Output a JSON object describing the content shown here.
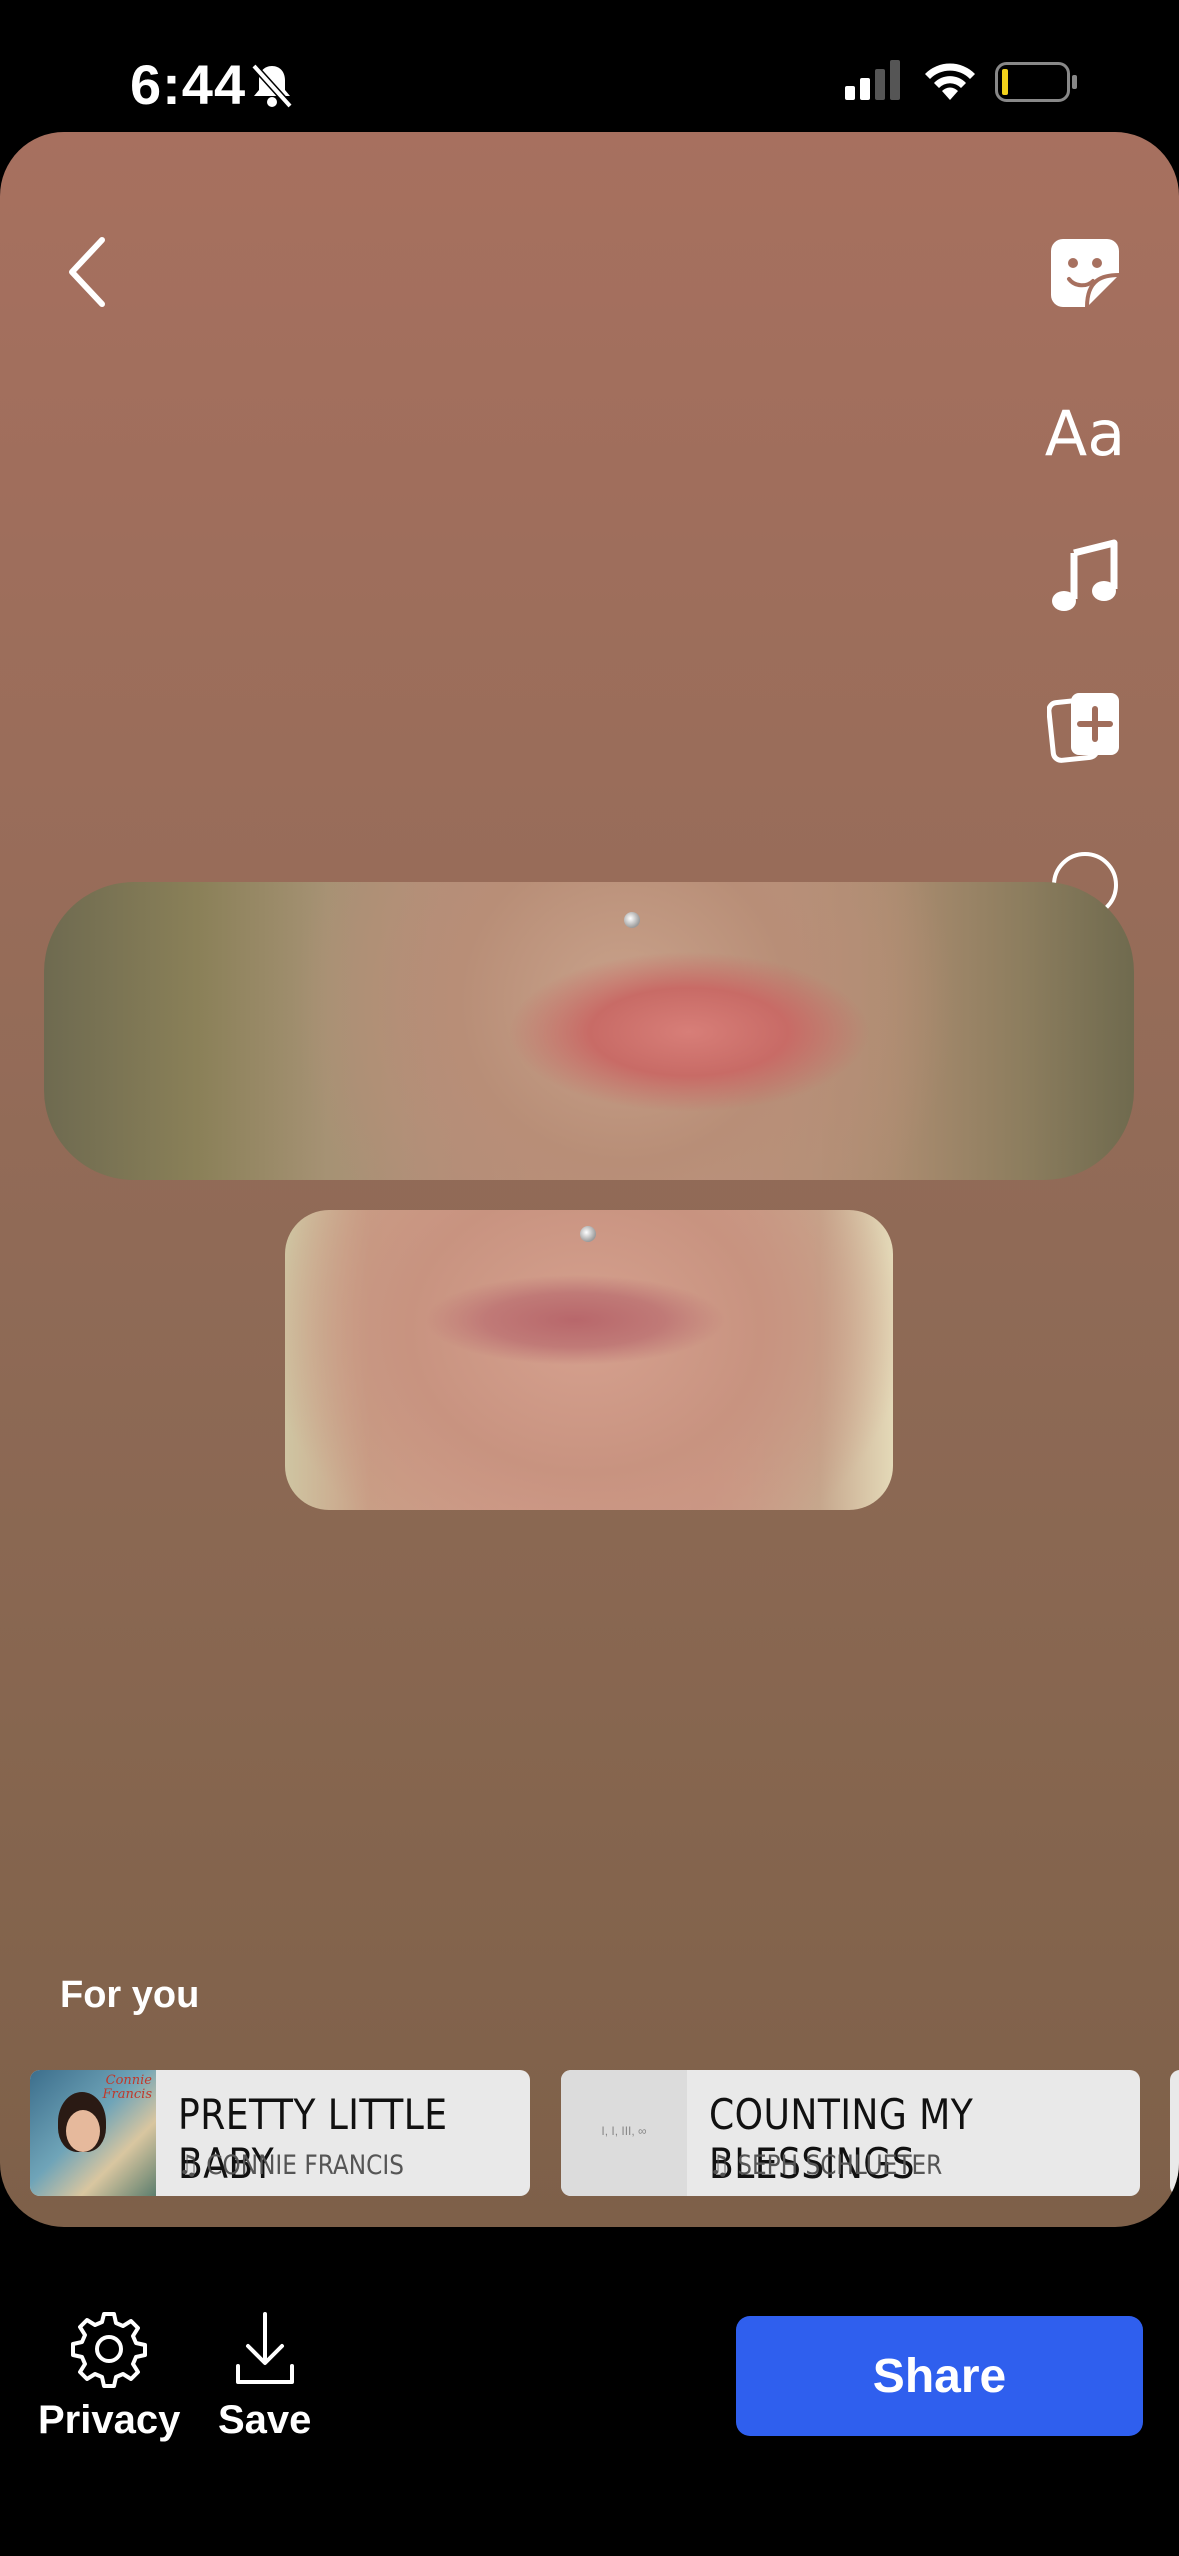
{
  "status_bar": {
    "time": "6:44"
  },
  "story_editor": {
    "tools": [
      "sticker-icon",
      "text-tool",
      "music-icon",
      "add-card-icon",
      "circle-icon",
      "chevron-down-icon"
    ],
    "text_tool_label": "Aa"
  },
  "music_suggestions": {
    "heading": "For you",
    "tracks": [
      {
        "title": "PRETTY LITTLE BABY",
        "artist": "CONNIE FRANCIS",
        "art_text": "Connie Francis"
      },
      {
        "title": "COUNTING MY BLESSINGS",
        "artist": "SEPH SCHLUETER",
        "art_text": "I, I, III, ∞"
      }
    ]
  },
  "bottom_bar": {
    "privacy_label": "Privacy",
    "save_label": "Save",
    "share_label": "Share"
  },
  "colors": {
    "share_button": "#2f5fee",
    "canvas_top": "#a7705f",
    "canvas_bottom": "#7e6049"
  }
}
